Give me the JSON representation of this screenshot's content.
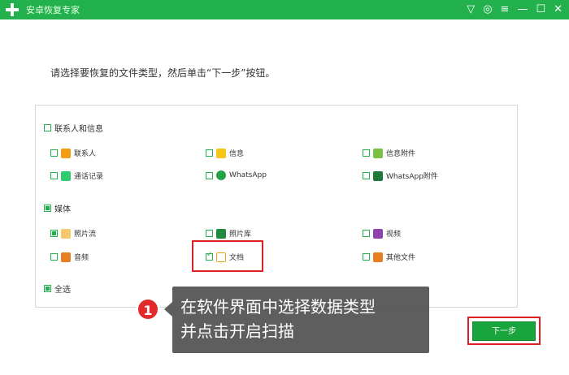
{
  "app": {
    "title": "安卓恢复专家"
  },
  "instruction": "请选择要恢复的文件类型，然后单击“下一步”按钮。",
  "groups": {
    "contacts": {
      "title": "联系人和信息",
      "items": [
        "联系人",
        "信息",
        "信息附件",
        "通话记录",
        "WhatsApp",
        "WhatsApp附件"
      ]
    },
    "media": {
      "title": "媒体",
      "items": [
        "照片流",
        "照片库",
        "视频",
        "音频",
        "文档",
        "其他文件"
      ]
    },
    "select_all": "全选"
  },
  "callout": {
    "badge": "1",
    "line1": "在软件界面中选择数据类型",
    "line2": "并点击开启扫描"
  },
  "buttons": {
    "next": "下一步"
  },
  "colors": {
    "brand": "#22b14c",
    "highlight": "#e02020"
  }
}
